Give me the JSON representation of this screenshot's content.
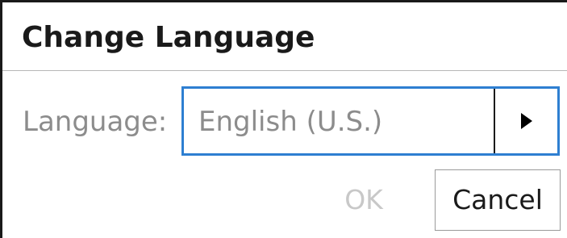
{
  "dialog": {
    "title": "Change Language",
    "language_label": "Language:",
    "language_select": {
      "selected_value": "English (U.S.)",
      "arrow_icon": "triangle-right-icon"
    },
    "ok_label": "OK",
    "ok_enabled": false,
    "cancel_label": "Cancel"
  },
  "colors": {
    "focus_border": "#2e7fd1",
    "disabled_text": "#c8c8c8",
    "label_text": "#8c8c8c",
    "primary_text": "#1a1a1a"
  }
}
